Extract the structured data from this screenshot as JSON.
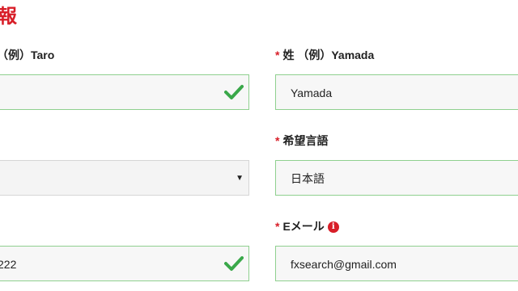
{
  "section": {
    "title": "報"
  },
  "form": {
    "first_name": {
      "label": "（例）Taro",
      "value": "",
      "valid": true
    },
    "last_name": {
      "required_mark": "*",
      "label": "姓 （例）Yamada",
      "value": "Yamada"
    },
    "country": {
      "label": "",
      "value": "",
      "caret": "▼"
    },
    "preferred_language": {
      "required_mark": "*",
      "label": "希望言語",
      "value": "日本語"
    },
    "phone": {
      "label": "",
      "value": "222",
      "valid": true
    },
    "email": {
      "required_mark": "*",
      "label": "Eメール",
      "info_icon": "i",
      "value": "fxsearch@gmail.com"
    }
  },
  "colors": {
    "accent_red": "#d81e28",
    "valid_green": "#3aa84a",
    "valid_border": "#8fd08f"
  }
}
